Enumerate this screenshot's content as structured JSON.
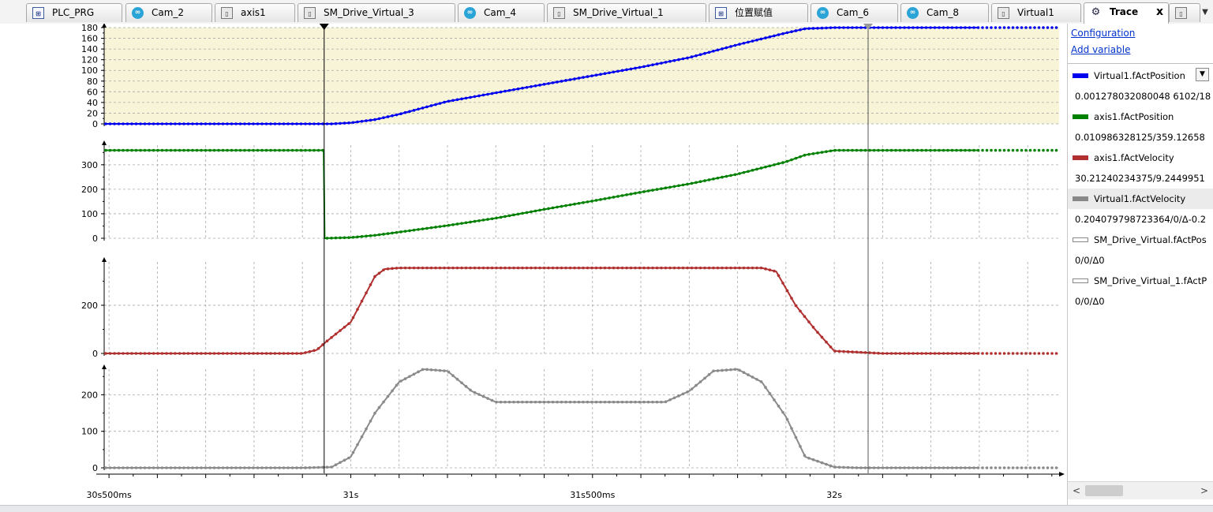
{
  "tabs": [
    {
      "label": "PLC_PRG",
      "icon": "program-icon",
      "kind": "prg",
      "active": false
    },
    {
      "label": "Cam_2",
      "icon": "cam-icon",
      "kind": "cam",
      "active": false
    },
    {
      "label": "axis1",
      "icon": "device-icon",
      "kind": "dev",
      "active": false
    },
    {
      "label": "SM_Drive_Virtual_3",
      "icon": "device-icon",
      "kind": "dev",
      "active": false
    },
    {
      "label": "Cam_4",
      "icon": "cam-icon",
      "kind": "cam",
      "active": false
    },
    {
      "label": "SM_Drive_Virtual_1",
      "icon": "device-icon",
      "kind": "dev",
      "active": false
    },
    {
      "label": "位置赋值",
      "icon": "program-icon",
      "kind": "prg",
      "active": false
    },
    {
      "label": "Cam_6",
      "icon": "cam-icon",
      "kind": "cam",
      "active": false
    },
    {
      "label": "Cam_8",
      "icon": "cam-icon",
      "kind": "cam",
      "active": false
    },
    {
      "label": "Virtual1",
      "icon": "device-icon",
      "kind": "dev",
      "active": false
    },
    {
      "label": "Trace",
      "icon": "trace-icon",
      "kind": "trc",
      "active": true
    },
    {
      "label": "",
      "icon": "device-icon",
      "kind": "dev",
      "active": false
    }
  ],
  "tab_close_glyph": "x",
  "panel": {
    "configuration_label": "Configuration",
    "add_variable_label": "Add variable",
    "variables": [
      {
        "name": "Virtual1.fActPosition",
        "color": "#0000ee",
        "value": "0.001278032080048 6102/18"
      },
      {
        "name": "axis1.fActPosition",
        "color": "#008000",
        "value": "0.010986328125/359.12658"
      },
      {
        "name": "axis1.fActVelocity",
        "color": "#b03030",
        "value": "30.21240234375/9.2449951"
      },
      {
        "name": "Virtual1.fActVelocity",
        "color": "#888888",
        "value": "0.204079798723364/0/Δ-0.2"
      },
      {
        "name": "SM_Drive_Virtual.fActPos",
        "color": "#ffffff",
        "value": "0/0/Δ0"
      },
      {
        "name": "SM_Drive_Virtual_1.fActP",
        "color": "#ffffff",
        "value": "0/0/Δ0"
      }
    ]
  },
  "colors": {
    "virtual1_position": "#0000ee",
    "axis1_position": "#008000",
    "axis1_velocity": "#b03030",
    "virtual1_velocity": "#8a8a8a",
    "highlight_band": "#f7f4d8",
    "grid": "#a8a8a8"
  },
  "chart_data": [
    {
      "type": "line",
      "title": "",
      "series": [
        {
          "name": "Virtual1.fActPosition",
          "color": "#0000ee"
        }
      ],
      "xlim": [
        30.49,
        31.94
      ],
      "ylim": [
        0,
        180
      ],
      "yticks": [
        0,
        20,
        40,
        60,
        80,
        100,
        120,
        140,
        160,
        180
      ],
      "x": [
        30.49,
        30.6,
        30.7,
        30.8,
        30.9,
        30.96,
        31.0,
        31.05,
        31.1,
        31.15,
        31.2,
        31.3,
        31.4,
        31.5,
        31.6,
        31.7,
        31.8,
        31.9,
        31.94,
        32.0,
        32.1,
        32.2,
        32.3
      ],
      "y": [
        0,
        0,
        0,
        0,
        0,
        0,
        2,
        8,
        18,
        30,
        42,
        58,
        74,
        90,
        106,
        124,
        148,
        170,
        178,
        180,
        180,
        180,
        180
      ]
    },
    {
      "type": "line",
      "series": [
        {
          "name": "axis1.fActPosition",
          "color": "#008000"
        }
      ],
      "ylim": [
        0,
        380
      ],
      "yticks": [
        0,
        100,
        200,
        300
      ],
      "x": [
        30.49,
        30.6,
        30.7,
        30.8,
        30.9,
        30.944,
        30.946,
        31.0,
        31.05,
        31.1,
        31.2,
        31.3,
        31.4,
        31.5,
        31.6,
        31.7,
        31.8,
        31.9,
        31.94,
        32.0,
        32.1,
        32.2,
        32.3
      ],
      "y": [
        359,
        359,
        359,
        359,
        359,
        359,
        0,
        3,
        12,
        25,
        52,
        82,
        118,
        152,
        188,
        222,
        262,
        312,
        340,
        359,
        359,
        359,
        359
      ]
    },
    {
      "type": "line",
      "series": [
        {
          "name": "axis1.fActVelocity",
          "color": "#b03030"
        }
      ],
      "ylim": [
        0,
        380
      ],
      "yticks": [
        0,
        200
      ],
      "x": [
        30.49,
        30.6,
        30.7,
        30.8,
        30.9,
        30.93,
        30.95,
        31.0,
        31.05,
        31.07,
        31.1,
        31.2,
        31.3,
        31.4,
        31.5,
        31.6,
        31.7,
        31.8,
        31.85,
        31.88,
        31.92,
        31.96,
        32.0,
        32.05,
        32.1,
        32.2,
        32.3
      ],
      "y": [
        0,
        0,
        0,
        0,
        0,
        15,
        50,
        130,
        320,
        350,
        355,
        355,
        355,
        355,
        355,
        355,
        355,
        355,
        355,
        340,
        200,
        100,
        10,
        5,
        0,
        0,
        0
      ]
    },
    {
      "type": "line",
      "series": [
        {
          "name": "Virtual1.fActVelocity",
          "color": "#8a8a8a"
        }
      ],
      "ylim": [
        0,
        270
      ],
      "yticks": [
        0,
        100,
        200
      ],
      "x": [
        30.49,
        30.6,
        30.7,
        30.8,
        30.9,
        30.96,
        31.0,
        31.05,
        31.1,
        31.15,
        31.2,
        31.25,
        31.3,
        31.35,
        31.4,
        31.5,
        31.6,
        31.65,
        31.7,
        31.75,
        31.8,
        31.85,
        31.9,
        31.94,
        32.0,
        32.05,
        32.1,
        32.2,
        32.3
      ],
      "y": [
        0,
        0,
        0,
        0,
        0,
        2,
        30,
        150,
        235,
        270,
        265,
        210,
        180,
        180,
        180,
        180,
        180,
        180,
        210,
        265,
        270,
        235,
        140,
        30,
        2,
        0,
        0,
        0,
        0
      ]
    }
  ],
  "time_axis": {
    "tick_labels": [
      "30s500ms",
      "31s",
      "31s500ms",
      "32s"
    ],
    "tick_values": [
      30.5,
      31.0,
      31.5,
      32.0
    ]
  },
  "cursors": {
    "cursor1_time": 30.945,
    "cursor2_time": 32.07
  }
}
